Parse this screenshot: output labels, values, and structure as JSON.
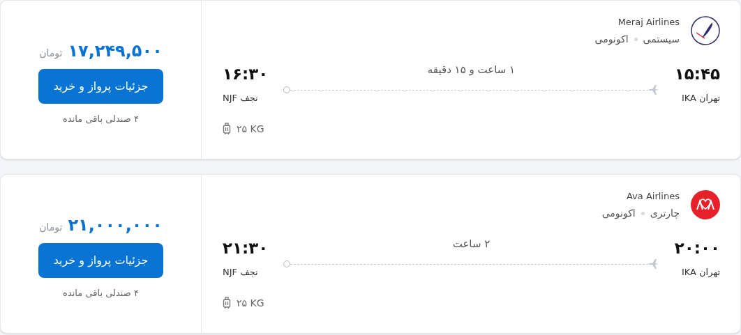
{
  "flights": [
    {
      "airline": "Meraj Airlines",
      "kind": "meraj",
      "flight_type": "سیستمی",
      "cabin": "اکونومی",
      "depart_time": "۱۵:۴۵",
      "depart_city": "تهران IKA",
      "duration": "۱ ساعت و ۱۵ دقیقه",
      "arrive_time": "۱۶:۳۰",
      "arrive_city": "نجف NJF",
      "baggage": "۲۵ KG",
      "price": "۱۷,۲۴۹,۵۰۰",
      "currency": "تومان",
      "button": "جزئیات پرواز و خرید",
      "seats": "۴ صندلی باقی مانده"
    },
    {
      "airline": "Ava Airlines",
      "kind": "ava",
      "flight_type": "چارتری",
      "cabin": "اکونومی",
      "depart_time": "۲۰:۰۰",
      "depart_city": "تهران IKA",
      "duration": "۲ ساعت",
      "arrive_time": "۲۱:۳۰",
      "arrive_city": "نجف NJF",
      "baggage": "۲۵ KG",
      "price": "۲۱,۰۰۰,۰۰۰",
      "currency": "تومان",
      "button": "جزئیات پرواز و خرید",
      "seats": "۴ صندلی باقی مانده"
    }
  ]
}
